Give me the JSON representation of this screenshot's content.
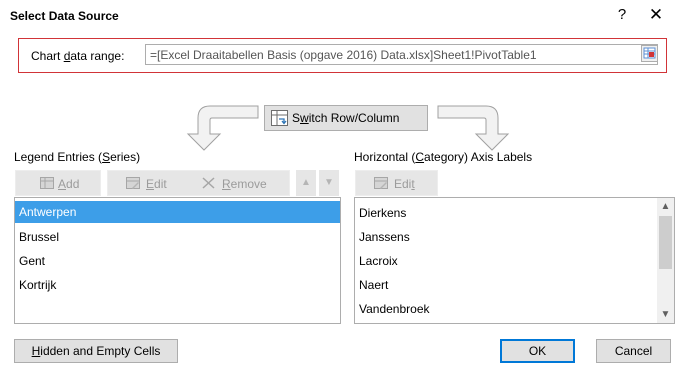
{
  "dialog": {
    "title": "Select Data Source",
    "help_glyph": "?",
    "close_glyph": "✕"
  },
  "range": {
    "label_pre": "Chart ",
    "label_key": "d",
    "label_post": "ata range:",
    "value": "=[Excel Draaitabellen Basis (opgave 2016) Data.xlsx]Sheet1!PivotTable1"
  },
  "switch": {
    "label_pre": "S",
    "label_key": "w",
    "label_post": "itch Row/Column"
  },
  "legend": {
    "header_pre": "Legend Entries (",
    "header_key": "S",
    "header_post": "eries)",
    "add_label_key": "A",
    "add_label_post": "dd",
    "edit_label_key": "E",
    "edit_label_post": "dit",
    "remove_label_key": "R",
    "remove_label_post": "emove",
    "up_glyph": "▲",
    "down_glyph": "▼",
    "items": [
      "Antwerpen",
      "Brussel",
      "Gent",
      "Kortrijk"
    ],
    "selected_index": 0
  },
  "axis": {
    "header_pre": "Horizontal (",
    "header_key": "C",
    "header_post": "ategory) Axis Labels",
    "edit_label_pre": "Edi",
    "edit_label_key": "t",
    "items": [
      "Dierkens",
      "Janssens",
      "Lacroix",
      "Naert",
      "Vandenbroek"
    ],
    "scroll_up_glyph": "▲",
    "scroll_down_glyph": "▼"
  },
  "footer": {
    "hidden_pre": "",
    "hidden_key": "H",
    "hidden_post": "idden and Empty Cells",
    "ok_label": "OK",
    "cancel_label": "Cancel"
  },
  "colors": {
    "accent_blue": "#0078d7",
    "selection": "#3d9ee8",
    "red_frame": "#d13438"
  },
  "icons": {
    "collapse": "range-collapse-icon",
    "switch": "switch-row-column-icon",
    "add": "add-series-icon",
    "edit": "edit-icon",
    "remove": "remove-x-icon"
  }
}
